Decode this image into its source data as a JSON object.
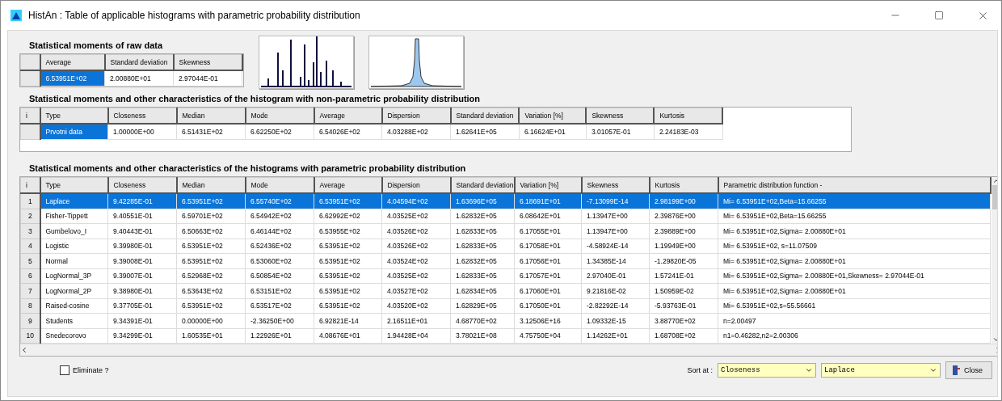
{
  "window": {
    "title": "HistAn : Table of applicable histograms with parametric probability distribution"
  },
  "raw_moments": {
    "title": "Statistical moments of raw data",
    "kind": "grid",
    "columns": [
      "Average",
      "Standard deviation",
      "Skewness"
    ],
    "rows": [
      {
        "cells": [
          "6.53951E+02",
          "2.00880E+01",
          "2.97044E-01"
        ],
        "selected": true
      }
    ]
  },
  "thumbnails": [
    {
      "kind": "spikes"
    },
    {
      "kind": "peak"
    }
  ],
  "nonparametric": {
    "title": "Statistical moments and other characteristics of the histogram with non-parametric probability distribution",
    "kind": "grid",
    "index_header": "i",
    "columns": [
      "Type",
      "Closeness",
      "Median",
      "Mode",
      "Average",
      "Dispersion",
      "Standard deviation",
      "Variation [%]",
      "Skewness",
      "Kurtosis"
    ],
    "rows": [
      {
        "cells": [
          "Prvotni data",
          "1.00000E+00",
          "6.51431E+02",
          "6.62250E+02",
          "6.54026E+02",
          "4.03288E+02",
          "1.62641E+05",
          "6.16624E+01",
          "3.01057E-01",
          "2.24183E-03"
        ],
        "selected": true
      }
    ]
  },
  "parametric": {
    "title": "Statistical moments and other characteristics of the histograms with parametric probability distribution",
    "kind": "list",
    "index_header": "i",
    "columns": [
      "Type",
      "Closeness",
      "Median",
      "Mode",
      "Average",
      "Dispersion",
      "Standard deviation",
      "Variation [%]",
      "Skewness",
      "Kurtosis",
      "Parametric distribution function -"
    ],
    "rows": [
      {
        "index": "1",
        "cells": [
          "Laplace",
          "9.42285E-01",
          "6.53951E+02",
          "6.55740E+02",
          "6.53951E+02",
          "4.04594E+02",
          "1.63696E+05",
          "6.18691E+01",
          "-7.13099E-14",
          "2.98199E+00",
          "Mi= 6.53951E+02,Beta=15.66255"
        ],
        "selected": true
      },
      {
        "index": "2",
        "cells": [
          "Fisher-Tippett",
          "9.40551E-01",
          "6.59701E+02",
          "6.54942E+02",
          "6.62992E+02",
          "4.03525E+02",
          "1.62832E+05",
          "6.08642E+01",
          "1.13947E+00",
          "2.39876E+00",
          "Mi= 6.53951E+02,Beta=15.66255"
        ],
        "selected": false
      },
      {
        "index": "3",
        "cells": [
          "Gumbelovo_I",
          "9.40443E-01",
          "6.50663E+02",
          "6.46144E+02",
          "6.53955E+02",
          "4.03526E+02",
          "1.62833E+05",
          "6.17055E+01",
          "1.13947E+00",
          "2.39889E+00",
          "Mi= 6.53951E+02,Sigma= 2.00880E+01"
        ],
        "selected": false
      },
      {
        "index": "4",
        "cells": [
          "Logistic",
          "9.39980E-01",
          "6.53951E+02",
          "6.52436E+02",
          "6.53951E+02",
          "4.03526E+02",
          "1.62833E+05",
          "6.17058E+01",
          "-4.58924E-14",
          "1.19949E+00",
          "Mi= 6.53951E+02, s=11.07509"
        ],
        "selected": false
      },
      {
        "index": "5",
        "cells": [
          "Normal",
          "9.39008E-01",
          "6.53951E+02",
          "6.53060E+02",
          "6.53951E+02",
          "4.03524E+02",
          "1.62832E+05",
          "6.17056E+01",
          "1.34385E-14",
          "-1.29820E-05",
          "Mi= 6.53951E+02,Sigma= 2.00880E+01"
        ],
        "selected": false
      },
      {
        "index": "6",
        "cells": [
          "LogNormal_3P",
          "9.39007E-01",
          "6.52968E+02",
          "6.50854E+02",
          "6.53951E+02",
          "4.03525E+02",
          "1.62833E+05",
          "6.17057E+01",
          "2.97040E-01",
          "1.57241E-01",
          "Mi= 6.53951E+02,Sigma= 2.00880E+01,Skewness= 2.97044E-01"
        ],
        "selected": false
      },
      {
        "index": "7",
        "cells": [
          "LogNormal_2P",
          "9.38980E-01",
          "6.53643E+02",
          "6.53151E+02",
          "6.53951E+02",
          "4.03527E+02",
          "1.62834E+05",
          "6.17060E+01",
          "9.21816E-02",
          "1.50959E-02",
          "Mi= 6.53951E+02,Sigma= 2.00880E+01"
        ],
        "selected": false
      },
      {
        "index": "8",
        "cells": [
          "Raised-cosine",
          "9.37705E-01",
          "6.53951E+02",
          "6.53517E+02",
          "6.53951E+02",
          "4.03520E+02",
          "1.62829E+05",
          "6.17050E+01",
          "-2.82292E-14",
          "-5.93763E-01",
          "Mi= 6.53951E+02,s=55.56661"
        ],
        "selected": false
      },
      {
        "index": "9",
        "cells": [
          "Students",
          "9.34391E-01",
          "0.00000E+00",
          "-2.36250E+00",
          "6.92821E-14",
          "2.16511E+01",
          "4.68770E+02",
          "3.12506E+16",
          "1.09332E-15",
          "3.88770E+02",
          "n=2.00497"
        ],
        "selected": false
      },
      {
        "index": "10",
        "cells": [
          "Snedecorovo",
          "9.34299E-01",
          "1.60535E+01",
          "1.22926E+01",
          "4.08676E+01",
          "1.94428E+04",
          "3.78021E+08",
          "4.75750E+04",
          "1.14262E+01",
          "1.68708E+02",
          "n1=0.46282,n2=2.00306"
        ],
        "selected": false
      }
    ]
  },
  "footer": {
    "eliminate": {
      "label": "Eliminate ?",
      "checked": false
    },
    "sort_label": "Sort at :",
    "sort_by": "Closeness",
    "distribution": "Laplace",
    "close_button": "Close"
  }
}
